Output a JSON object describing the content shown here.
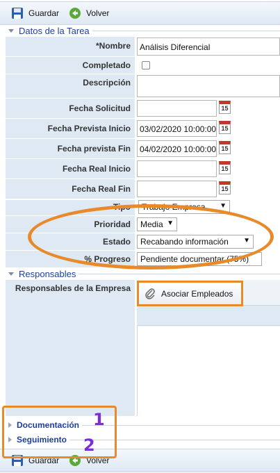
{
  "toolbar": {
    "save_label": "Guardar",
    "back_label": "Volver"
  },
  "task_section": {
    "title": "Datos de la Tarea",
    "fields": {
      "name": {
        "label": "*Nombre",
        "value": "Análisis Diferencial"
      },
      "completed": {
        "label": "Completado",
        "checked": false
      },
      "description": {
        "label": "Descripción",
        "value": ""
      },
      "requested_date": {
        "label": "Fecha Solicitud",
        "value": "",
        "calendar_day": "15"
      },
      "planned_start": {
        "label": "Fecha Prevista Inicio",
        "value": "03/02/2020 10:00:00",
        "calendar_day": "15"
      },
      "planned_end": {
        "label": "Fecha prevista Fin",
        "value": "04/02/2020 10:00:00",
        "calendar_day": "15"
      },
      "actual_start": {
        "label": "Fecha Real Inicio",
        "value": "",
        "calendar_day": "15"
      },
      "actual_end": {
        "label": "Fecha Real Fin",
        "value": "",
        "calendar_day": "15"
      },
      "type": {
        "label": "Tipo",
        "value": "Trabajo Empresa"
      },
      "priority": {
        "label": "Prioridad",
        "value": "Media"
      },
      "status": {
        "label": "Estado",
        "value": "Recabando información"
      },
      "progress": {
        "label": "% Progreso",
        "value": "Pendiente documentar (75%)"
      }
    }
  },
  "responsables_section": {
    "title": "Responsables",
    "company_label": "Responsables de la Empresa",
    "associate_button": "Asociar Empleados"
  },
  "collapsed_sections": [
    {
      "title": "Documentación"
    },
    {
      "title": "Seguimiento"
    }
  ],
  "annotations": {
    "number_1": "1",
    "number_2": "2",
    "highlight_color": "#e8892a",
    "number_color": "#7a2fd6"
  },
  "icons": {
    "save": "floppy-disk-icon",
    "back": "green-arrow-back-icon",
    "calendar": "calendar-icon",
    "paperclip": "paperclip-icon"
  }
}
